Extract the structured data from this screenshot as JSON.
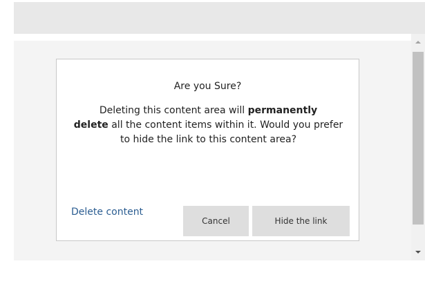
{
  "dialog": {
    "title": "Are you Sure?",
    "message_part1": "Deleting this content area will ",
    "message_bold1": "permanently",
    "message_bold2": "delete",
    "message_part2": " all the content items within it. Would you prefer to hide the link to this content area?",
    "delete_link": "Delete content",
    "cancel_label": "Cancel",
    "hide_label": "Hide the link"
  },
  "colors": {
    "link": "#2b5d91",
    "button_bg": "#dedede",
    "panel_bg": "#f4f4f4",
    "top_bar_bg": "#e8e8e8"
  }
}
